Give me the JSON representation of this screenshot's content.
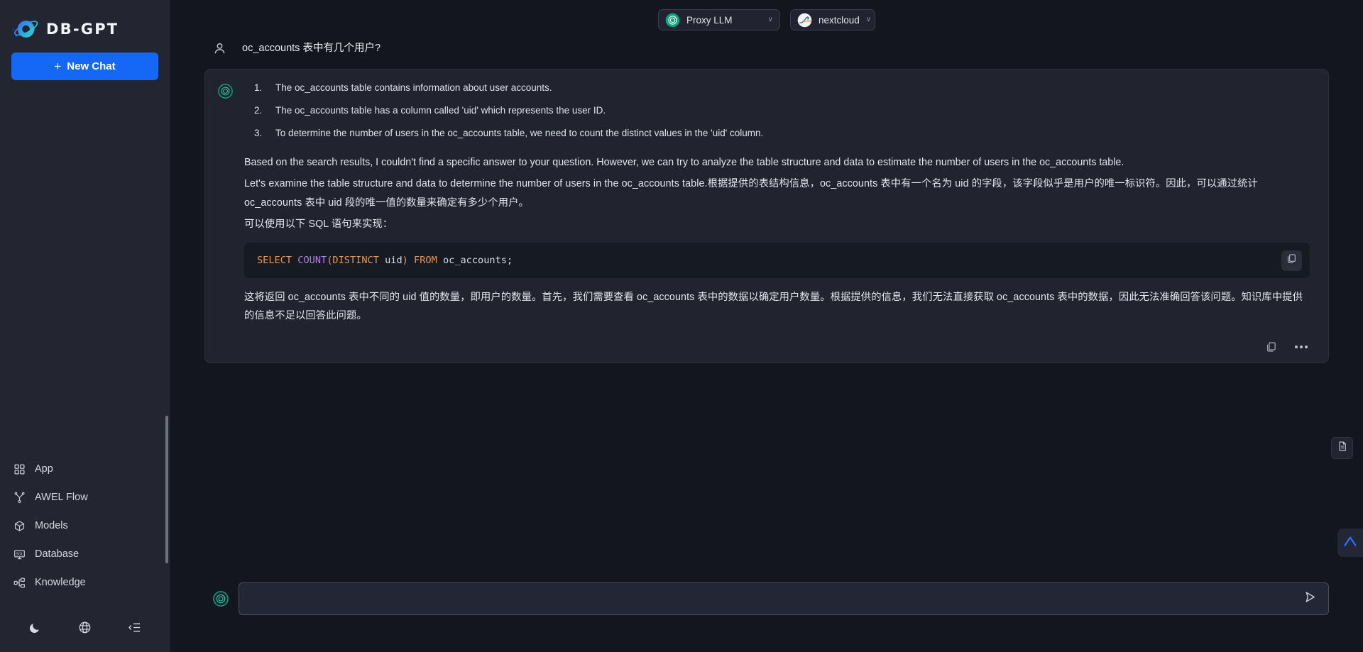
{
  "brand": {
    "name": "DB-GPT"
  },
  "sidebar": {
    "new_chat_label": "New Chat",
    "new_chat_plus": "+",
    "items": [
      {
        "label": "App",
        "icon": "grid-icon"
      },
      {
        "label": "AWEL Flow",
        "icon": "flow-icon"
      },
      {
        "label": "Models",
        "icon": "cube-icon"
      },
      {
        "label": "Database",
        "icon": "database-icon"
      },
      {
        "label": "Knowledge",
        "icon": "knowledge-icon"
      }
    ],
    "bottom_icons": [
      {
        "name": "dark-mode-icon"
      },
      {
        "name": "language-globe-icon"
      },
      {
        "name": "collapse-sidebar-icon"
      }
    ]
  },
  "topbar": {
    "model_select": {
      "label": "Proxy LLM",
      "icon": "openai-icon",
      "caret": "∨"
    },
    "db_select": {
      "label": "nextcloud",
      "icon": "mysql-icon",
      "caret": "∨"
    }
  },
  "conversation": {
    "user_message": "oc_accounts 表中有几个用户?",
    "assistant": {
      "steps": [
        "The oc_accounts table contains information about user accounts.",
        "The oc_accounts table has a column called 'uid' which represents the user ID.",
        "To determine the number of users in the oc_accounts table, we need to count the distinct values in the 'uid' column."
      ],
      "paragraph_1": "Based on the search results, I couldn't find a specific answer to your question. However, we can try to analyze the table structure and data to estimate the number of users in the oc_accounts table.",
      "paragraph_2": "Let's examine the table structure and data to determine the number of users in the oc_accounts table.根据提供的表结构信息，oc_accounts 表中有一个名为 uid 的字段，该字段似乎是用户的唯一标识符。因此，可以通过统计 oc_accounts 表中 uid 段的唯一值的数量来确定有多少个用户。",
      "paragraph_3": "可以使用以下 SQL 语句来实现：",
      "code": {
        "language": "sql",
        "tokens": [
          {
            "t": "SELECT",
            "c": "kw"
          },
          {
            "t": " ",
            "c": "id"
          },
          {
            "t": "COUNT",
            "c": "fn"
          },
          {
            "t": "(",
            "c": "pn"
          },
          {
            "t": "DISTINCT",
            "c": "kw"
          },
          {
            "t": " uid",
            "c": "id"
          },
          {
            "t": ")",
            "c": "pn"
          },
          {
            "t": " ",
            "c": "id"
          },
          {
            "t": "FROM",
            "c": "kw"
          },
          {
            "t": " oc_accounts;",
            "c": "id"
          }
        ],
        "plain": "SELECT COUNT(DISTINCT uid) FROM oc_accounts;",
        "copy_icon": "copy-icon"
      },
      "paragraph_4": "这将返回 oc_accounts 表中不同的 uid 值的数量，即用户的数量。首先，我们需要查看 oc_accounts 表中的数据以确定用户数量。根据提供的信息，我们无法直接获取 oc_accounts 表中的数据，因此无法准确回答该问题。知识库中提供的信息不足以回答此问题。",
      "actions": [
        {
          "name": "copy-message-icon"
        },
        {
          "name": "more-options-icon"
        }
      ]
    }
  },
  "floating": {
    "document_icon": "document-icon",
    "scroll_top_icon": "scroll-to-top-icon"
  },
  "composer": {
    "value": "",
    "placeholder": "",
    "send_icon": "send-icon",
    "avatar_icon": "assistant-avatar-icon"
  },
  "colors": {
    "accent": "#1567f5",
    "sidebar_bg": "#232530",
    "main_bg": "#14161f",
    "card_bg": "#21242f",
    "code_bg": "#161a23",
    "brand_teal": "#10a37f"
  }
}
